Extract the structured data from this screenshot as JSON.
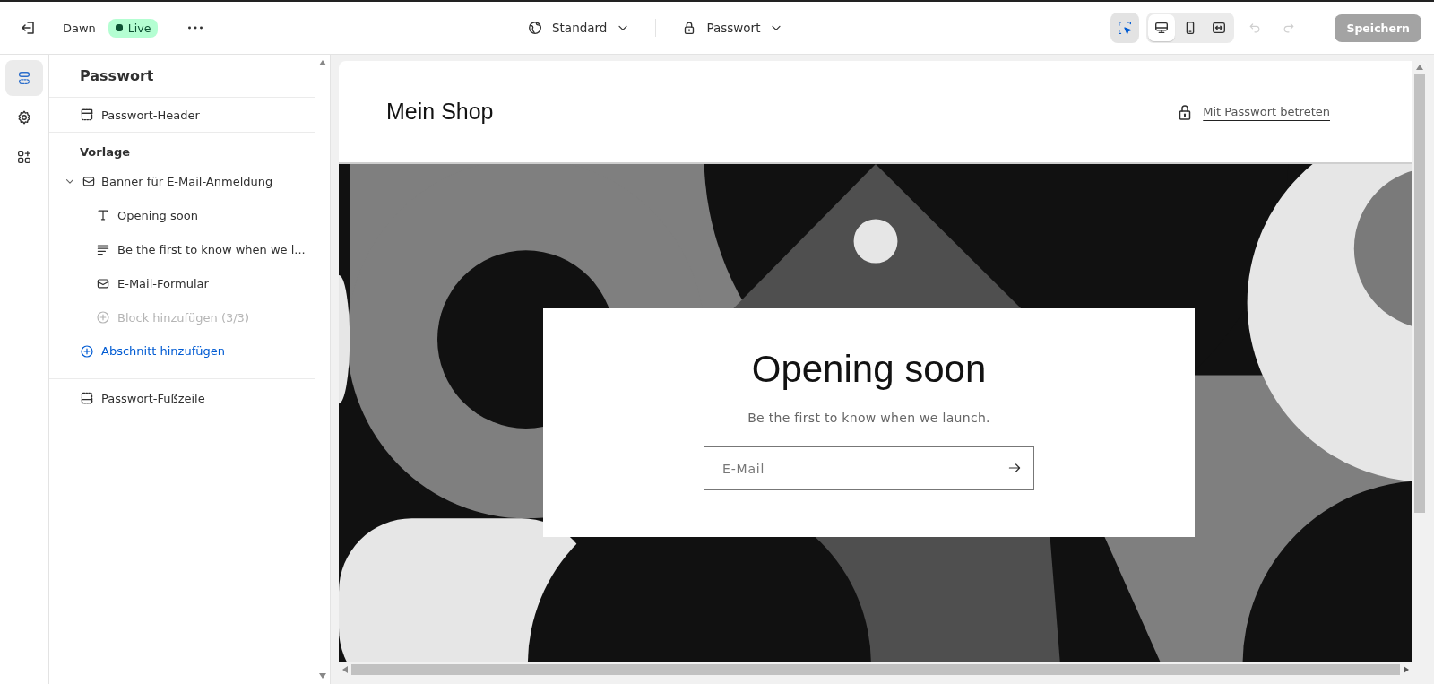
{
  "topbar": {
    "theme_name": "Dawn",
    "status": "Live",
    "template": "Standard",
    "page": "Passwort",
    "inspect": {
      "selected": true
    },
    "views": [
      {
        "kind": "desktop",
        "selected": true
      },
      {
        "kind": "mobile",
        "selected": false
      },
      {
        "kind": "fullwidth",
        "selected": false
      }
    ],
    "undo": {
      "disabled": true
    },
    "redo": {
      "disabled": true
    },
    "save": {
      "label": "Speichern",
      "disabled": true
    }
  },
  "rail": [
    {
      "kind": "sections",
      "selected": true
    },
    {
      "kind": "settings",
      "selected": false
    },
    {
      "kind": "apps",
      "selected": false
    }
  ],
  "sidebar": {
    "title": "Passwort",
    "header_section": {
      "label": "Passwort-Header",
      "kind": "header"
    },
    "template_group": {
      "title": "Vorlage",
      "sections": [
        {
          "label": "Banner für E-Mail-Anmeldung",
          "kind": "email",
          "expanded": true,
          "children": [
            {
              "label": "Opening soon",
              "kind": "heading"
            },
            {
              "label": "Be the first to know when we l...",
              "kind": "paragraph"
            },
            {
              "label": "E-Mail-Formular",
              "kind": "email"
            }
          ],
          "add_block": {
            "label": "Block hinzufügen (3/3)",
            "disabled": true
          }
        }
      ],
      "add_section": "Abschnitt hinzufügen"
    },
    "footer_section": {
      "label": "Passwort-Fußzeile",
      "kind": "footer"
    }
  },
  "preview": {
    "shop_name": "Mein Shop",
    "login_link": "Mit Passwort betreten",
    "banner": {
      "kind": "picture",
      "heading": "Opening soon",
      "text": "Be the first to know when we launch.",
      "email_placeholder": "E-Mail"
    }
  }
}
